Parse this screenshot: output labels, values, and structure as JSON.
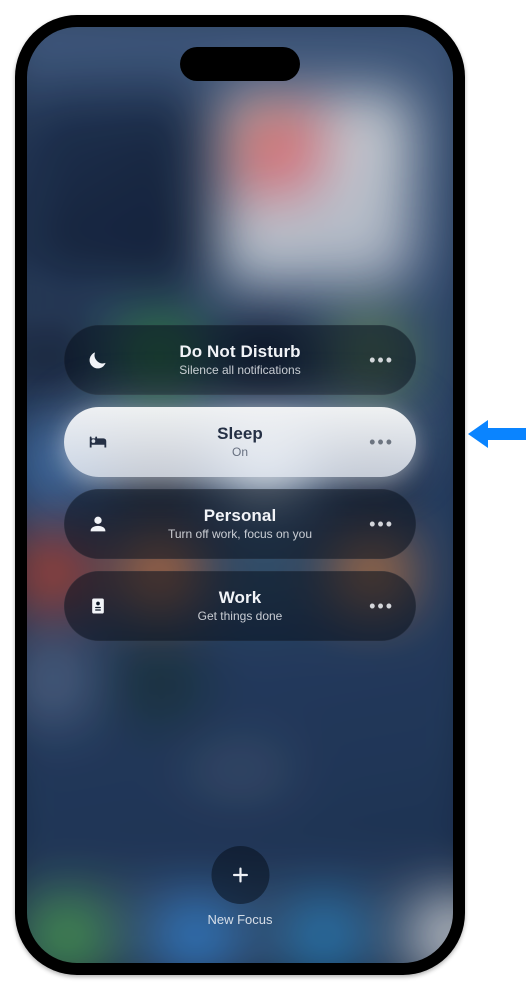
{
  "modes": [
    {
      "id": "dnd",
      "icon": "moon",
      "title": "Do Not Disturb",
      "subtitle": "Silence all notifications",
      "active": false
    },
    {
      "id": "sleep",
      "icon": "bed",
      "title": "Sleep",
      "subtitle": "On",
      "active": true
    },
    {
      "id": "personal",
      "icon": "person",
      "title": "Personal",
      "subtitle": "Turn off work, focus on you",
      "active": false
    },
    {
      "id": "work",
      "icon": "badge",
      "title": "Work",
      "subtitle": "Get things done",
      "active": false
    }
  ],
  "newFocus": {
    "label": "New Focus"
  },
  "callout": {
    "target_mode": "sleep"
  },
  "glyphs": {
    "more": "•••",
    "plus": "+"
  }
}
